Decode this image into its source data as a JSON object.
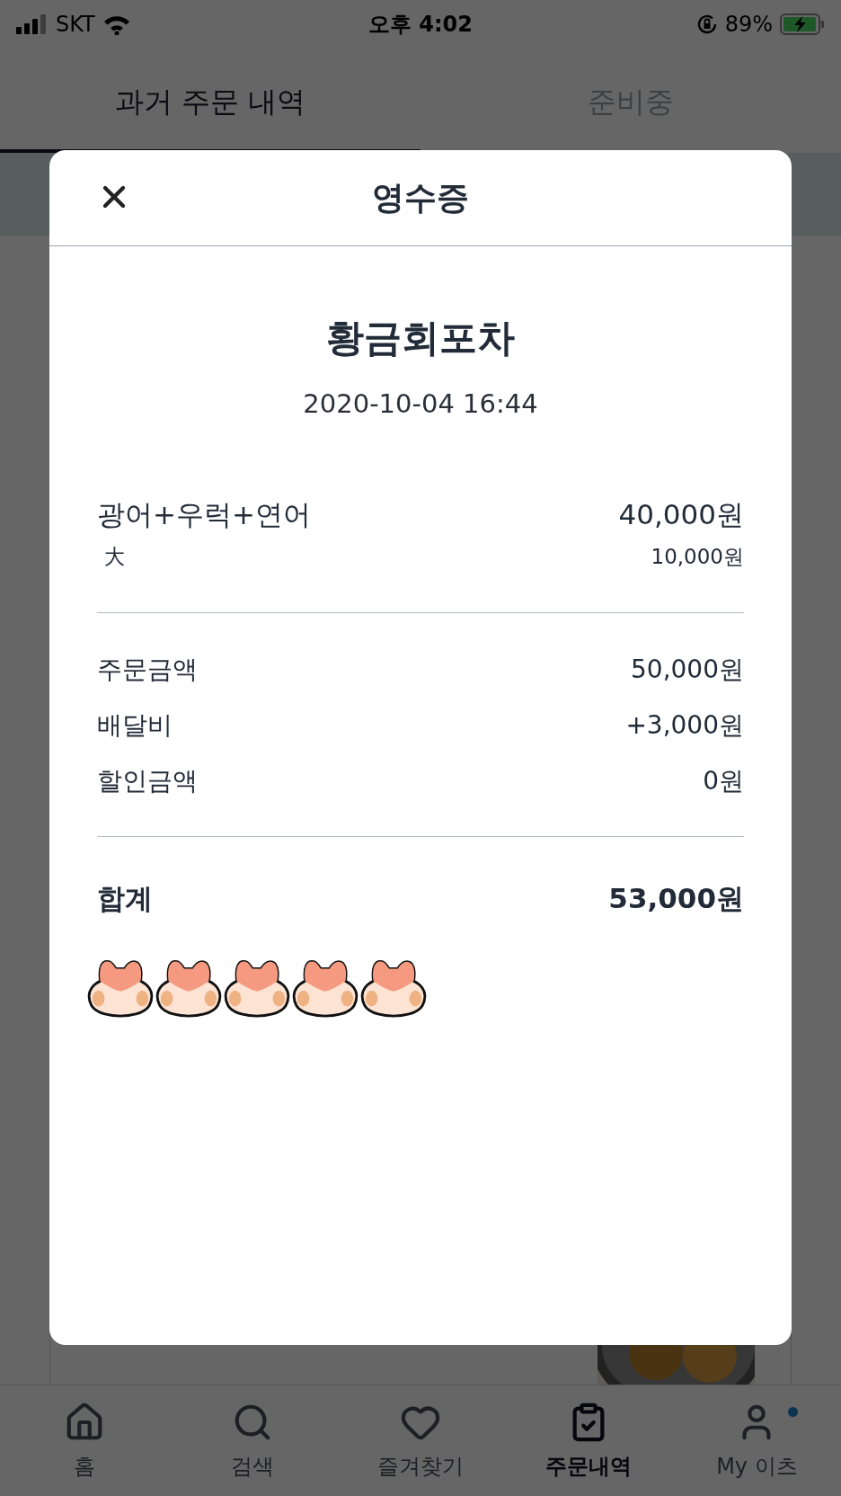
{
  "status_bar": {
    "carrier": "SKT",
    "time": "오후 4:02",
    "battery": "89%"
  },
  "tabs": [
    {
      "label": "과거 주문 내역",
      "selected": true
    },
    {
      "label": "준비중",
      "selected": false
    }
  ],
  "receipt": {
    "title": "영수증",
    "store": "황금회포차",
    "datetime": "2020-10-04 16:44",
    "items": [
      {
        "name": "광어+우럭+연어",
        "price": "40,000원",
        "options": [
          {
            "name": "大",
            "price": "10,000원"
          }
        ]
      }
    ],
    "summary": [
      {
        "label": "주문금액",
        "value": "50,000원"
      },
      {
        "label": "배달비",
        "value": "+3,000원"
      },
      {
        "label": "할인금액",
        "value": "0원"
      }
    ],
    "total": {
      "label": "합계",
      "value": "53,000원"
    },
    "rating": {
      "stars": 5
    }
  },
  "bottom_nav": [
    {
      "label": "홈",
      "kind": "home",
      "selected": false,
      "notification": false
    },
    {
      "label": "검색",
      "kind": "search",
      "selected": false,
      "notification": false
    },
    {
      "label": "즐겨찾기",
      "kind": "favorites",
      "selected": false,
      "notification": false
    },
    {
      "label": "주문내역",
      "kind": "orders",
      "selected": true,
      "notification": false
    },
    {
      "label": "My 이츠",
      "kind": "profile",
      "selected": false,
      "notification": true
    }
  ]
}
